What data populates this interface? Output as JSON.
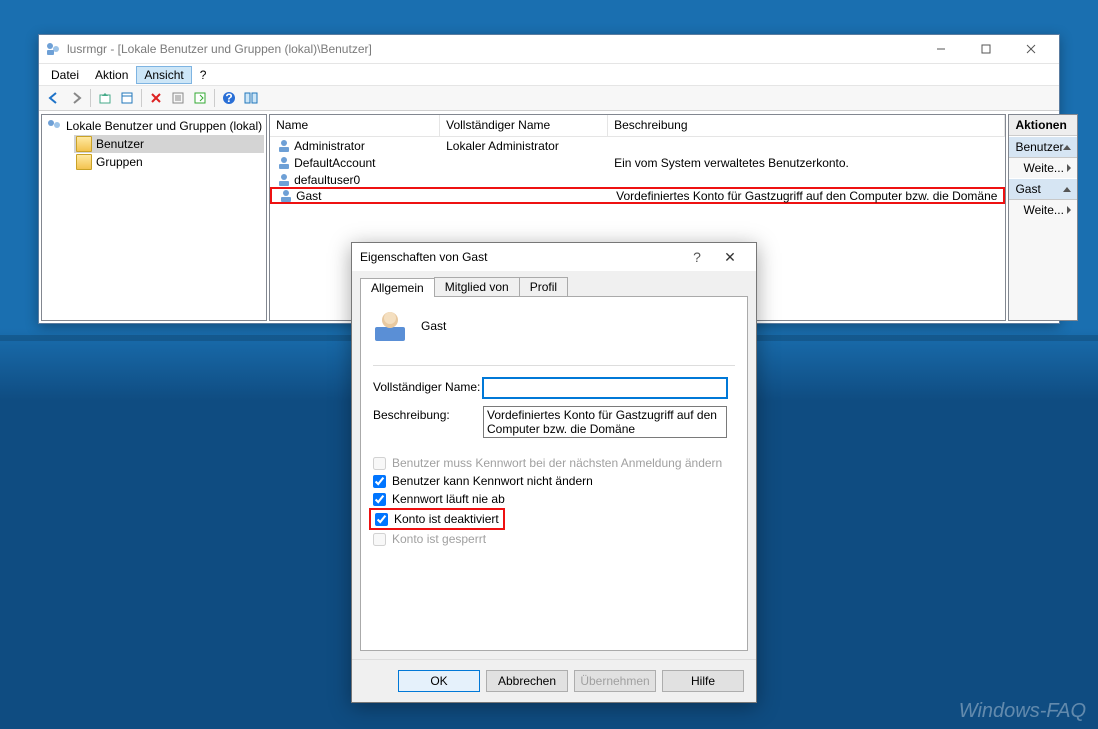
{
  "window": {
    "title": "lusrmgr - [Lokale Benutzer und Gruppen (lokal)\\Benutzer]",
    "menu": {
      "file": "Datei",
      "action": "Aktion",
      "view": "Ansicht",
      "help": "?"
    }
  },
  "tree": {
    "root": "Lokale Benutzer und Gruppen (lokal)",
    "items": [
      {
        "label": "Benutzer",
        "selected": true
      },
      {
        "label": "Gruppen",
        "selected": false
      }
    ]
  },
  "list": {
    "columns": {
      "name": "Name",
      "fullname": "Vollständiger Name",
      "desc": "Beschreibung"
    },
    "rows": [
      {
        "name": "Administrator",
        "fullname": "Lokaler Administrator",
        "desc": "",
        "hl": false
      },
      {
        "name": "DefaultAccount",
        "fullname": "",
        "desc": "Ein vom System verwaltetes Benutzerkonto.",
        "hl": false
      },
      {
        "name": "defaultuser0",
        "fullname": "",
        "desc": "",
        "hl": false
      },
      {
        "name": "Gast",
        "fullname": "",
        "desc": "Vordefiniertes Konto für Gastzugriff auf den Computer bzw. die Domäne",
        "hl": true
      }
    ]
  },
  "actions": {
    "title": "Aktionen",
    "sections": [
      {
        "header": "Benutzer",
        "link": "Weite..."
      },
      {
        "header": "Gast",
        "link": "Weite..."
      }
    ]
  },
  "dialog": {
    "title": "Eigenschaften von Gast",
    "tabs": {
      "general": "Allgemein",
      "member": "Mitglied von",
      "profile": "Profil"
    },
    "username": "Gast",
    "labels": {
      "fullname": "Vollständiger Name:",
      "desc": "Beschreibung:"
    },
    "values": {
      "fullname": "",
      "desc": "Vordefiniertes Konto für Gastzugriff auf den Computer bzw. die Domäne"
    },
    "checks": {
      "must_change": "Benutzer muss Kennwort bei der nächsten Anmeldung ändern",
      "cant_change": "Benutzer kann Kennwort nicht ändern",
      "never_expires": "Kennwort läuft nie ab",
      "disabled": "Konto ist deaktiviert",
      "locked": "Konto ist gesperrt"
    },
    "buttons": {
      "ok": "OK",
      "cancel": "Abbrechen",
      "apply": "Übernehmen",
      "help": "Hilfe"
    }
  },
  "watermark": "Windows-FAQ"
}
